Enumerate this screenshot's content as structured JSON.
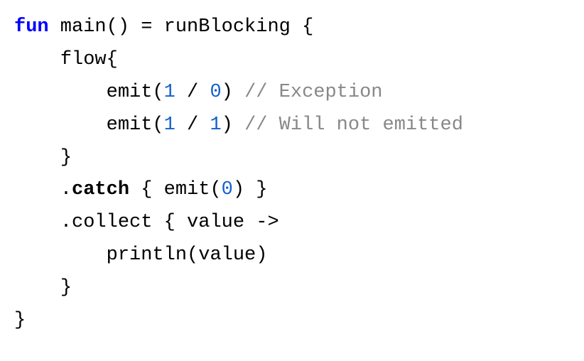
{
  "code": {
    "line1": {
      "fun": "fun",
      "main": " main() = runBlocking {"
    },
    "line2": {
      "indent": "    ",
      "flow": "flow{"
    },
    "line3": {
      "indent": "        ",
      "emit": "emit(",
      "num1": "1",
      "div": " / ",
      "num2": "0",
      "close": ") ",
      "comment": "// Exception"
    },
    "line4": {
      "indent": "        ",
      "emit": "emit(",
      "num1": "1",
      "div": " / ",
      "num2": "1",
      "close": ") ",
      "comment": "// Will not emitted"
    },
    "line5": {
      "indent": "    ",
      "brace": "}"
    },
    "line6": {
      "indent": "    ",
      "dot": ".",
      "catch": "catch",
      "rest1": " { emit(",
      "num": "0",
      "rest2": ") }"
    },
    "line7": {
      "indent": "    ",
      "collect": ".collect { value ->"
    },
    "line8": {
      "indent": "        ",
      "println": "println(value)"
    },
    "line9": {
      "indent": "    ",
      "brace": "}"
    },
    "line10": {
      "brace": "}"
    }
  }
}
